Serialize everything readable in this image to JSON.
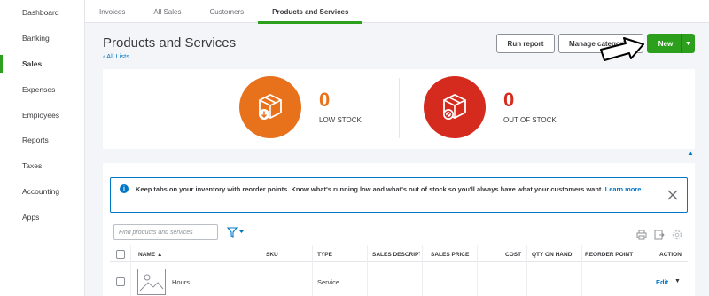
{
  "sidebar": {
    "items": [
      {
        "label": "Dashboard"
      },
      {
        "label": "Banking"
      },
      {
        "label": "Sales"
      },
      {
        "label": "Expenses"
      },
      {
        "label": "Employees"
      },
      {
        "label": "Reports"
      },
      {
        "label": "Taxes"
      },
      {
        "label": "Accounting"
      },
      {
        "label": "Apps"
      }
    ],
    "active": "Sales"
  },
  "tabs": [
    {
      "label": "Invoices"
    },
    {
      "label": "All Sales"
    },
    {
      "label": "Customers"
    },
    {
      "label": "Products and Services"
    }
  ],
  "header": {
    "title": "Products and Services",
    "back_link": "All Lists",
    "run_report": "Run report",
    "manage_categories": "Manage categories",
    "new": "New"
  },
  "stock": {
    "low": {
      "count": "0",
      "label": "LOW STOCK"
    },
    "out": {
      "count": "0",
      "label": "OUT OF STOCK"
    }
  },
  "banner": {
    "text": "Keep tabs on your inventory with reorder points. Know what's running low and what's out of stock so you'll always have what your customers want.",
    "link": "Learn more"
  },
  "search": {
    "placeholder": "Find products and services",
    "value": ""
  },
  "table": {
    "columns": [
      "NAME ▲",
      "SKU",
      "TYPE",
      "SALES DESCRIPTION",
      "SALES PRICE",
      "COST",
      "QTY ON HAND",
      "REORDER POINT",
      "ACTION"
    ],
    "rows": [
      {
        "name": "Hours",
        "sku": "",
        "type": "Service",
        "action": "Edit"
      }
    ]
  },
  "colors": {
    "accent": "#2ca01c",
    "link": "#0077c5",
    "low_stock": "#e8721c",
    "out_of_stock": "#d52b1e"
  }
}
